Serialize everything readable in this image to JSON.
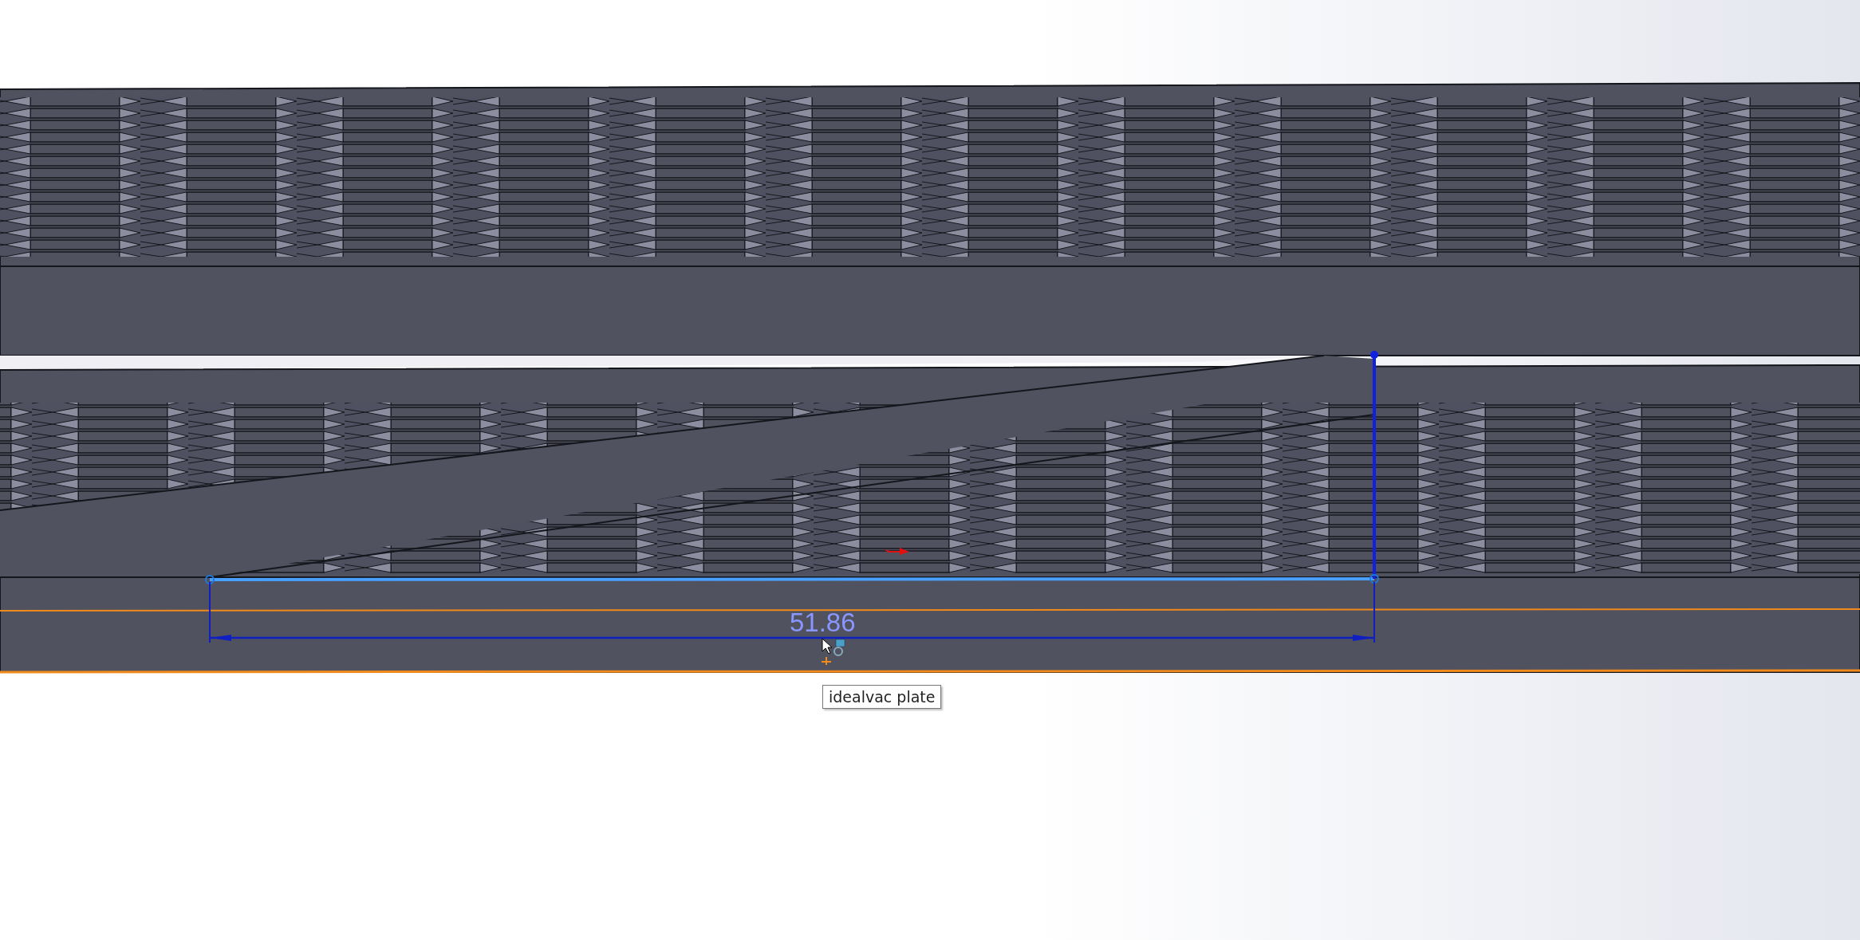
{
  "viewport": {
    "dimension": {
      "value": "51.86"
    },
    "tooltip": {
      "text": "idealvac plate"
    }
  }
}
